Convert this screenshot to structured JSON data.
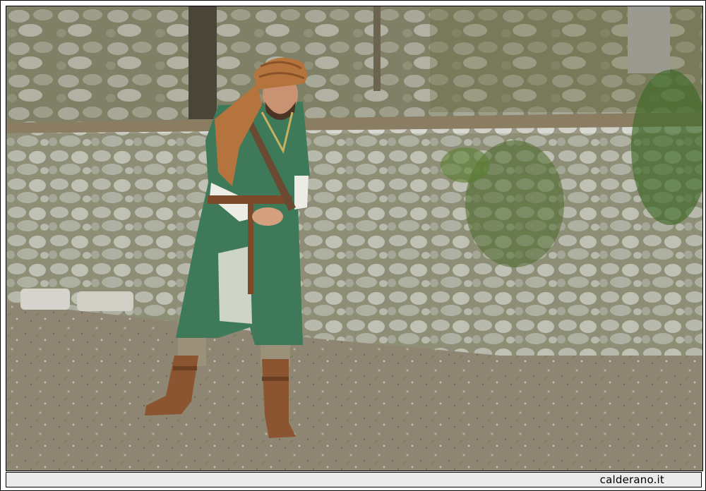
{
  "watermark": {
    "text": "calderano.it"
  },
  "colors": {
    "tunic": "#3e7a5a",
    "turban": "#b5733d",
    "boots": "#8a5530",
    "ground": "#8d8470",
    "stone": "#c9c9c2",
    "moss": "#6f7a4a",
    "caption_bar": "#ebebeb"
  }
}
